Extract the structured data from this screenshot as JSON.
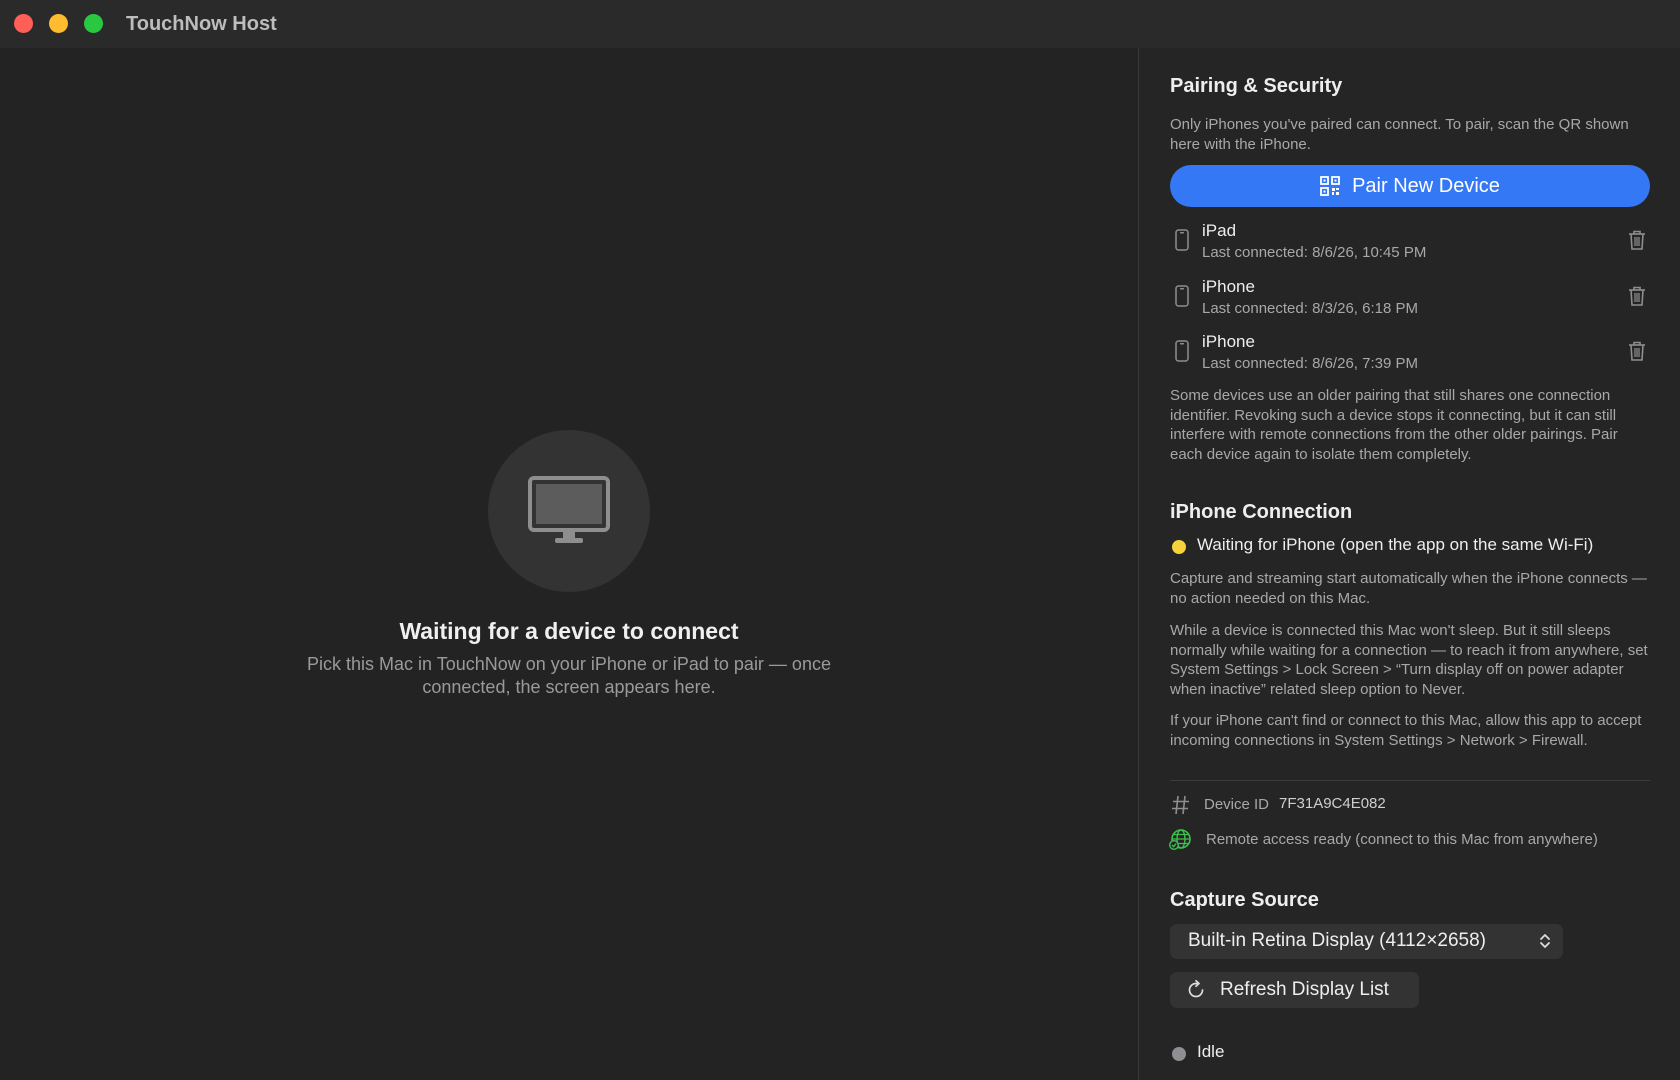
{
  "window": {
    "title": "TouchNow Host"
  },
  "main": {
    "icon": "display-icon",
    "title": "Waiting for a device to connect",
    "subtitle": "Pick this Mac in TouchNow on your iPhone or iPad to pair — once connected, the screen appears here."
  },
  "pairing": {
    "heading": "Pairing & Security",
    "description": "Only iPhones you've paired can connect. To pair, scan the QR shown here with the iPhone.",
    "pair_button_label": "Pair New Device",
    "pair_button_icon": "qr-code-icon",
    "accent_color": "#3478f6",
    "devices": [
      {
        "name": "iPad",
        "last": "Last connected: 8/6/26, 10:45 PM"
      },
      {
        "name": "iPhone",
        "last": "Last connected: 8/3/26, 6:18 PM"
      },
      {
        "name": "iPhone",
        "last": "Last connected: 8/6/26, 7:39 PM"
      }
    ],
    "note": "Some devices use an older pairing that still shares one connection identifier. Revoking such a device stops it connecting, but it can still interfere with remote connections from the other older pairings. Pair each device again to isolate them completely."
  },
  "connection": {
    "heading": "iPhone Connection",
    "status": "Waiting for iPhone (open the app on the same Wi-Fi)",
    "status_color": "#f5d33a",
    "para1": "Capture and streaming start automatically when the iPhone connects — no action needed on this Mac.",
    "para2": "While a device is connected this Mac won't sleep. But it still sleeps normally while waiting for a connection — to reach it from anywhere, set System Settings > Lock Screen > “Turn display off on power adapter when inactive” related sleep option to Never.",
    "para3": "If your iPhone can't find or connect to this Mac, allow this app to accept incoming connections in System Settings > Network > Firewall.",
    "device_id_label": "Device ID",
    "device_id_value": "7F31A9C4E082",
    "remote_text": "Remote access ready (connect to this Mac from anywhere)",
    "remote_color": "#3fbf4f"
  },
  "capture": {
    "heading": "Capture Source",
    "selected_display": "Built-in Retina Display (4112×2658)",
    "refresh_label": "Refresh Display List",
    "status": "Idle",
    "status_color": "#8e8e93"
  }
}
